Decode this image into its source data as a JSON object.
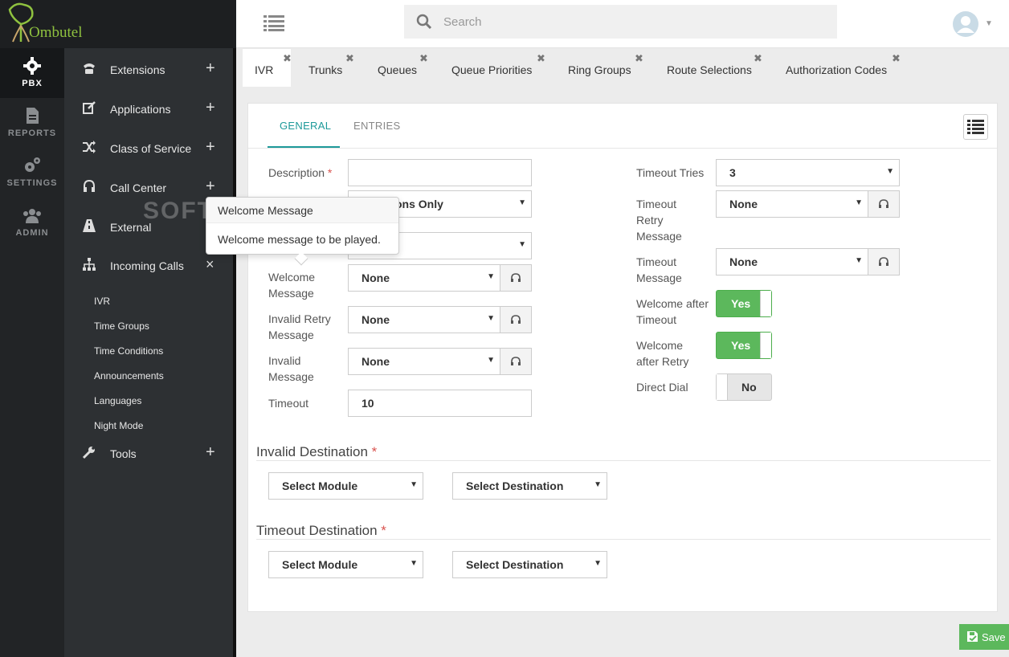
{
  "app": {
    "name": "Ombutel"
  },
  "rail": [
    {
      "label": "PBX",
      "icon": "gear-icon"
    },
    {
      "label": "REPORTS",
      "icon": "document-icon"
    },
    {
      "label": "SETTINGS",
      "icon": "cogs-icon"
    },
    {
      "label": "ADMIN",
      "icon": "users-icon"
    }
  ],
  "menu": {
    "items": [
      {
        "label": "Extensions",
        "icon": "phone-icon",
        "toggle": "+"
      },
      {
        "label": "Applications",
        "icon": "edit-icon",
        "toggle": "+"
      },
      {
        "label": "Class of Service",
        "icon": "shuffle-icon",
        "toggle": "+"
      },
      {
        "label": "Call Center",
        "icon": "headset-icon",
        "toggle": "+"
      },
      {
        "label": "External",
        "icon": "road-icon",
        "toggle": ""
      },
      {
        "label": "Incoming Calls",
        "icon": "sitemap-icon",
        "toggle": "×"
      },
      {
        "label": "Tools",
        "icon": "wrench-icon",
        "toggle": "+"
      }
    ],
    "incoming_sub": [
      "IVR",
      "Time Groups",
      "Time Conditions",
      "Announcements",
      "Languages",
      "Night Mode"
    ]
  },
  "search": {
    "placeholder": "Search"
  },
  "tabs": [
    "IVR",
    "Trunks",
    "Queues",
    "Queue Priorities",
    "Ring Groups",
    "Route Selections",
    "Authorization Codes"
  ],
  "panel_tabs": [
    "GENERAL",
    "ENTRIES"
  ],
  "form": {
    "description_label": "Description",
    "hidden_select_value": "ons Only",
    "welcome_label": "Welcome Message",
    "welcome_value": "None",
    "invalid_retry_label": "Invalid Retry Message",
    "invalid_retry_value": "None",
    "invalid_label": "Invalid Message",
    "invalid_value": "None",
    "timeout_label": "Timeout",
    "timeout_value": "10",
    "timeout_tries_label": "Timeout Tries",
    "timeout_tries_value": "3",
    "timeout_retry_label": "Timeout Retry Message",
    "timeout_retry_value": "None",
    "timeout_msg_label": "Timeout Message",
    "timeout_msg_value": "None",
    "welcome_after_timeout_label": "Welcome after Timeout",
    "welcome_after_timeout_value": "Yes",
    "welcome_after_retry_label": "Welcome after Retry",
    "welcome_after_retry_value": "Yes",
    "direct_dial_label": "Direct Dial",
    "direct_dial_value": "No"
  },
  "invalid_destination": {
    "title": "Invalid Destination",
    "module": "Select Module",
    "destination": "Select Destination"
  },
  "timeout_destination": {
    "title": "Timeout Destination",
    "module": "Select Module",
    "destination": "Select Destination"
  },
  "tooltip": {
    "title": "Welcome Message",
    "body": "Welcome message to be played."
  },
  "watermark": "SOFTPEDIA",
  "save_label": "Save",
  "colors": {
    "accent": "#1e9a9a",
    "success": "#5cb85c",
    "brand": "#8fc23f",
    "required": "#d9534f"
  }
}
